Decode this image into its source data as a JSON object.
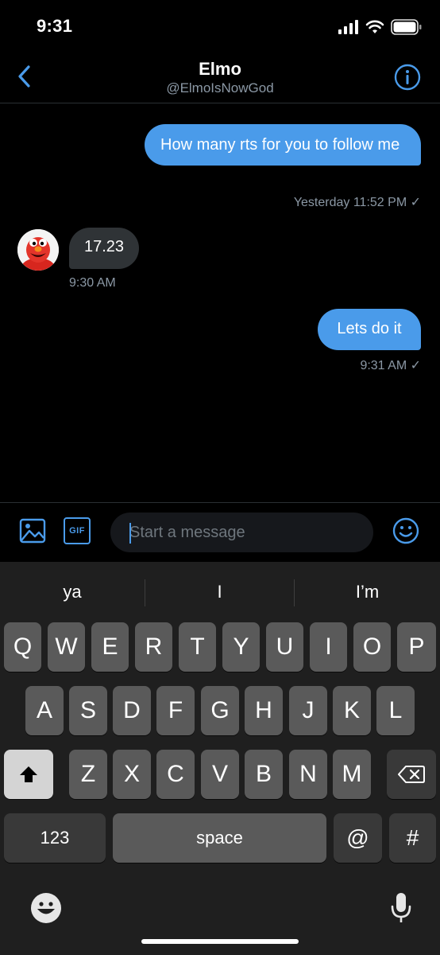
{
  "status": {
    "time": "9:31"
  },
  "header": {
    "name": "Elmo",
    "handle": "@ElmoIsNowGod"
  },
  "messages": [
    {
      "direction": "outgoing",
      "text": "How many rts for you to follow me",
      "meta": "Yesterday 11:52 PM ✓"
    },
    {
      "direction": "incoming",
      "text": "17.23",
      "meta": "9:30 AM"
    },
    {
      "direction": "outgoing",
      "text": "Lets do it",
      "meta": "9:31 AM ✓"
    }
  ],
  "composer": {
    "placeholder": "Start a message",
    "gif_label": "GIF"
  },
  "keyboard": {
    "suggestions": [
      "ya",
      "I",
      "I’m"
    ],
    "row1": [
      "Q",
      "W",
      "E",
      "R",
      "T",
      "Y",
      "U",
      "I",
      "O",
      "P"
    ],
    "row2": [
      "A",
      "S",
      "D",
      "F",
      "G",
      "H",
      "J",
      "K",
      "L"
    ],
    "row3": [
      "Z",
      "X",
      "C",
      "V",
      "B",
      "N",
      "M"
    ],
    "numbers_label": "123",
    "space_label": "space",
    "at_label": "@",
    "hash_label": "#"
  },
  "colors": {
    "accent": "#4a9bea",
    "incoming_bubble": "#2f3336",
    "meta_text": "#8b98a5"
  },
  "icons": [
    "back-chevron-icon",
    "info-icon",
    "image-icon",
    "gif-icon",
    "emoji-icon",
    "shift-icon",
    "backspace-icon",
    "emoji-keyboard-icon",
    "microphone-icon",
    "signal-icon",
    "wifi-icon",
    "battery-icon"
  ]
}
